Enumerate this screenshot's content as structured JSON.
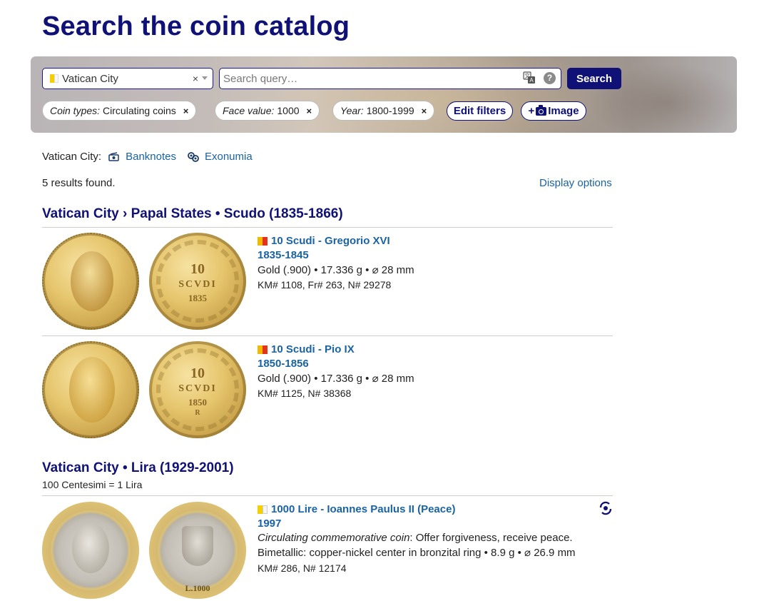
{
  "page": {
    "title": "Search the coin catalog"
  },
  "search": {
    "country": "Vatican City",
    "clear_symbol": "×",
    "query_placeholder": "Search query…",
    "help_symbol": "?",
    "button": "Search"
  },
  "filters": [
    {
      "name": "Coin types:",
      "value": "Circulating coins",
      "remove": "×"
    },
    {
      "name": "Face value:",
      "value": "1000",
      "remove": "×"
    },
    {
      "name": "Year:",
      "value": "1800-1999",
      "remove": "×"
    }
  ],
  "actions": {
    "edit_filters": "Edit filters",
    "add_image_plus": "+",
    "add_image_label": "Image"
  },
  "related": {
    "label": "Vatican City:",
    "banknotes": "Banknotes",
    "exonumia": "Exonumia"
  },
  "results": {
    "count": "5 results found.",
    "display_options": "Display options"
  },
  "sections": [
    {
      "title": "Vatican City › Papal States • Scudo (1835-1866)",
      "coins": [
        {
          "title": "10 Scudi - Gregorio XVI",
          "years": "1835-1845",
          "spec": "Gold (.900) • 17.336 g • ⌀ 28 mm",
          "refs": "KM# 1108, Fr# 263, N# 29278",
          "obverse_color": "#e0c06a",
          "reverse_lines": [
            "10",
            "SCVDI",
            "1835"
          ]
        },
        {
          "title": "10 Scudi - Pio IX",
          "years": "1850-1856",
          "spec": "Gold (.900) • 17.336 g • ⌀ 28 mm",
          "refs": "KM# 1125, N# 38368",
          "obverse_color": "#e9c95d",
          "reverse_lines": [
            "10",
            "SCVDI",
            "1850",
            "R"
          ]
        }
      ]
    },
    {
      "title": "Vatican City • Lira (1929-2001)",
      "subtitle": "100 Centesimi = 1 Lira",
      "coins": [
        {
          "title": "1000 Lire - Ioannes Paulus II (Peace)",
          "years": "1997",
          "type_label": "Circulating commemorative coin",
          "type_desc": ": Offer forgiveness, receive peace.",
          "spec": "Bimetallic: copper-nickel center in bronzital ring • 8.9 g • ⌀ 26.9 mm",
          "refs": "KM# 286, N# 12174",
          "reverse_value": "L.1000"
        }
      ]
    }
  ],
  "colors": {
    "brand": "#0f1177",
    "link": "#1a63a3",
    "divider": "#cccccc"
  }
}
